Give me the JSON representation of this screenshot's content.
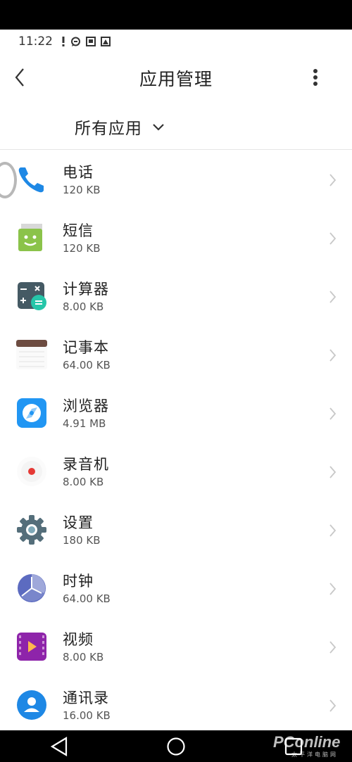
{
  "status_bar": {
    "time": "11:22",
    "icons": [
      "alert-icon",
      "chat-icon",
      "notification-icon",
      "image-icon"
    ]
  },
  "header": {
    "title": "应用管理",
    "back_icon": "back-arrow-icon",
    "more_icon": "more-vert-icon"
  },
  "filter": {
    "label": "所有应用",
    "icon": "chevron-down-icon"
  },
  "apps": [
    {
      "name": "电话",
      "size": "120 KB",
      "icon": "phone-icon",
      "color": "#1e88e5"
    },
    {
      "name": "短信",
      "size": "120 KB",
      "icon": "sms-icon",
      "color": "#8bc34a"
    },
    {
      "name": "计算器",
      "size": "8.00 KB",
      "icon": "calculator-icon",
      "color": "#455a64"
    },
    {
      "name": "记事本",
      "size": "64.00 KB",
      "icon": "notepad-icon",
      "color": "#6d4c41"
    },
    {
      "name": "浏览器",
      "size": "4.91 MB",
      "icon": "browser-icon",
      "color": "#2196f3"
    },
    {
      "name": "录音机",
      "size": "8.00 KB",
      "icon": "recorder-icon",
      "color": "#e53935"
    },
    {
      "name": "设置",
      "size": "180 KB",
      "icon": "settings-icon",
      "color": "#546e7a"
    },
    {
      "name": "时钟",
      "size": "64.00 KB",
      "icon": "clock-icon",
      "color": "#5c6bc0"
    },
    {
      "name": "视频",
      "size": "8.00 KB",
      "icon": "video-icon",
      "color": "#8e24aa"
    },
    {
      "name": "通讯录",
      "size": "16.00 KB",
      "icon": "contacts-icon",
      "color": "#1e88e5"
    }
  ],
  "nav_bar": {
    "back": "nav-back-icon",
    "home": "nav-home-icon",
    "recent": "nav-recent-icon"
  },
  "watermark": {
    "brand": "PConline",
    "sub": "太平洋电脑网"
  }
}
